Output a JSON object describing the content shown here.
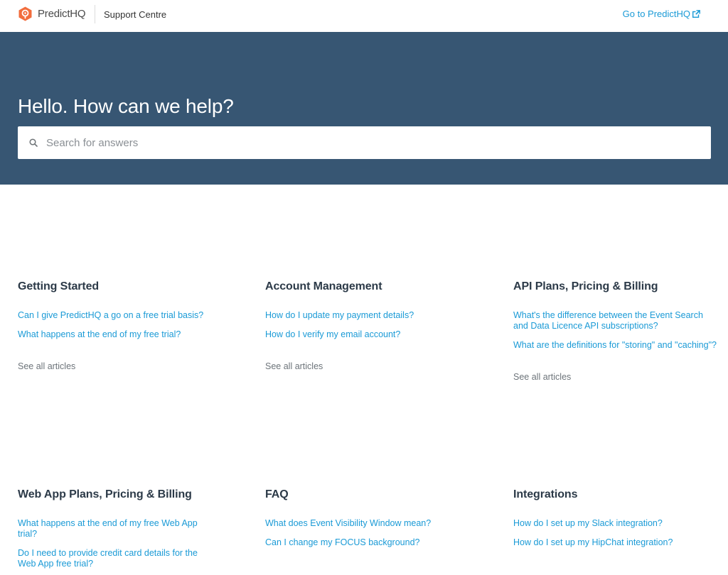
{
  "header": {
    "brand_name": "PredictHQ",
    "support_centre": "Support Centre",
    "goto_link": "Go to PredictHQ"
  },
  "hero": {
    "title": "Hello. How can we help?",
    "search_placeholder": "Search for answers"
  },
  "colors": {
    "hero_bg": "#375673",
    "link": "#1a9ad6",
    "logo_orange": "#f26d3d"
  },
  "see_all_label": "See all articles",
  "categories": [
    {
      "title": "Getting Started",
      "articles": [
        "Can I give PredictHQ a go on a free trial basis?",
        "What happens at the end of my free trial?"
      ]
    },
    {
      "title": "Account Management",
      "articles": [
        "How do I update my payment details?",
        "How do I verify my email account?"
      ]
    },
    {
      "title": "API Plans, Pricing & Billing",
      "articles": [
        "What's the difference between the Event Search and Data Licence API subscriptions?",
        "What are the definitions for \"storing\" and \"caching\"?"
      ]
    },
    {
      "title": "Web App Plans, Pricing & Billing",
      "articles": [
        "What happens at the end of my free Web App trial?",
        "Do I need to provide credit card details for the Web App free trial?"
      ]
    },
    {
      "title": "FAQ",
      "articles": [
        "What does Event Visibility Window mean?",
        "Can I change my FOCUS background?"
      ]
    },
    {
      "title": "Integrations",
      "articles": [
        "How do I set up my Slack integration?",
        "How do I set up my HipChat integration?"
      ]
    }
  ]
}
